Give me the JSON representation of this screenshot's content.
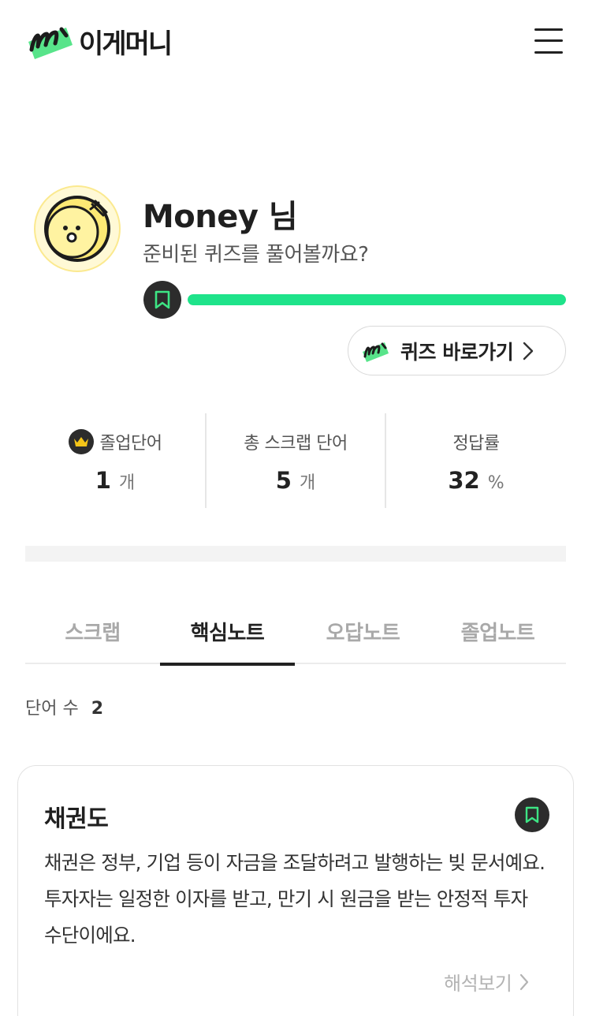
{
  "header": {
    "logo_text": "이게머니",
    "menu_icon": "hamburger-menu-icon"
  },
  "profile": {
    "name": "Money 님",
    "subtitle": "준비된 퀴즈를 풀어볼까요?",
    "progress_fraction": 1.0
  },
  "quiz_button": {
    "label": "퀴즈 바로가기"
  },
  "stats": [
    {
      "label": "졸업단어",
      "value": "1",
      "unit": "개"
    },
    {
      "label": "총 스크랩 단어",
      "value": "5",
      "unit": "개"
    },
    {
      "label": "정답률",
      "value": "32",
      "unit": "%"
    }
  ],
  "tabs": [
    {
      "label": "스크랩",
      "active": false
    },
    {
      "label": "핵심노트",
      "active": true
    },
    {
      "label": "오답노트",
      "active": false
    },
    {
      "label": "졸업노트",
      "active": false
    }
  ],
  "word_count": {
    "label": "단어 수",
    "value": "2"
  },
  "card": {
    "title": "채권도",
    "description": "채권은 정부, 기업 등이 자금을 조달하려고 발행하는 빚 문서예요. 투자자는 일정한 이자를 받고, 만기 시 원금을 받는 안정적 투자 수단이에요.",
    "more_label": "해석보기"
  },
  "colors": {
    "accent": "#1ee38a",
    "dark": "#2c2c2c",
    "avatar_bg": "#fff9d6",
    "crown": "#f5c518"
  }
}
